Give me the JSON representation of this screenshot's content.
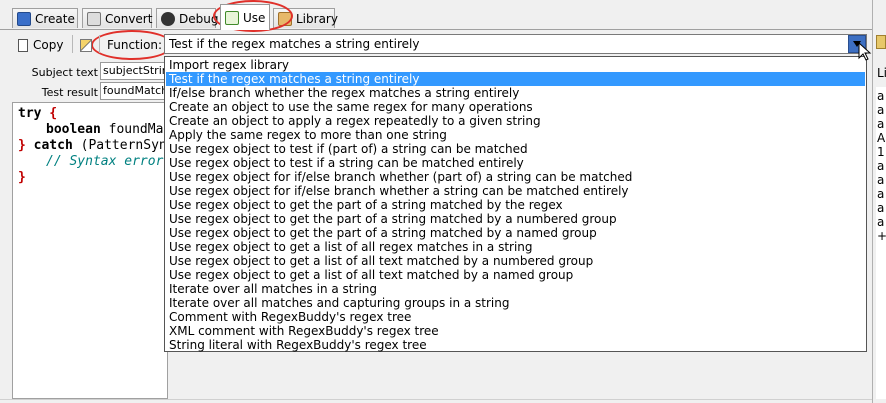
{
  "tabs": [
    {
      "label": "Create",
      "icon": "create-icon"
    },
    {
      "label": "Convert",
      "icon": "convert-icon"
    },
    {
      "label": "Debug",
      "icon": "debug-icon"
    },
    {
      "label": "Use",
      "icon": "use-icon"
    },
    {
      "label": "Library",
      "icon": "library-icon"
    }
  ],
  "active_tab": "Use",
  "toolbar": {
    "copy_label": "Copy",
    "function_label": "Function:",
    "function_value": "Test if the regex matches a string entirely"
  },
  "form": {
    "subject_label": "Subject text",
    "subject_value": "subjectString",
    "result_label": "Test result",
    "result_value": "foundMatch"
  },
  "code": {
    "line1_kw": "try",
    "line1_rest": " {",
    "line2_kw": "boolean",
    "line2_rest": " foundMa",
    "line3_brace": "}",
    "line3_kw": " catch",
    "line3_rest": " (PatternSyn",
    "line4_comment": "// Syntax error",
    "line5_brace": "}"
  },
  "dropdown": {
    "selected_index": 1,
    "items": [
      "Import regex library",
      "Test if the regex matches a string entirely",
      "If/else branch whether the regex matches a string entirely",
      "Create an object to use the same regex for many operations",
      "Create an object to apply a regex repeatedly to a given string",
      "Apply the same regex to more than one string",
      "Use regex object to test if (part of) a string can be matched",
      "Use regex object to test if a string can be matched entirely",
      "Use regex object for if/else branch whether (part of) a string can be matched",
      "Use regex object for if/else branch whether a string can be matched entirely",
      "Use regex object to get the part of a string matched by the regex",
      "Use regex object to get the part of a string matched by a numbered group",
      "Use regex object to get the part of a string matched by a named group",
      "Use regex object to get a list of all regex matches in a string",
      "Use regex object to get a list of all text matched by a numbered group",
      "Use regex object to get a list of all text matched by a named group",
      "Iterate over all matches in a string",
      "Iterate over all matches and capturing groups in a string",
      "Comment with RegexBuddy's regex tree",
      "XML comment with RegexBuddy's regex tree",
      "String literal with RegexBuddy's regex tree"
    ]
  },
  "right_panel": {
    "header": "Li",
    "items": [
      "a",
      "a",
      "a",
      "A",
      "1",
      "a",
      "a",
      "a",
      "a",
      "a",
      "+"
    ]
  },
  "colors": {
    "selection": "#3399ff",
    "annotation_circle": "#e0302a",
    "keyword_red": "#c00000",
    "comment": "#008080"
  }
}
